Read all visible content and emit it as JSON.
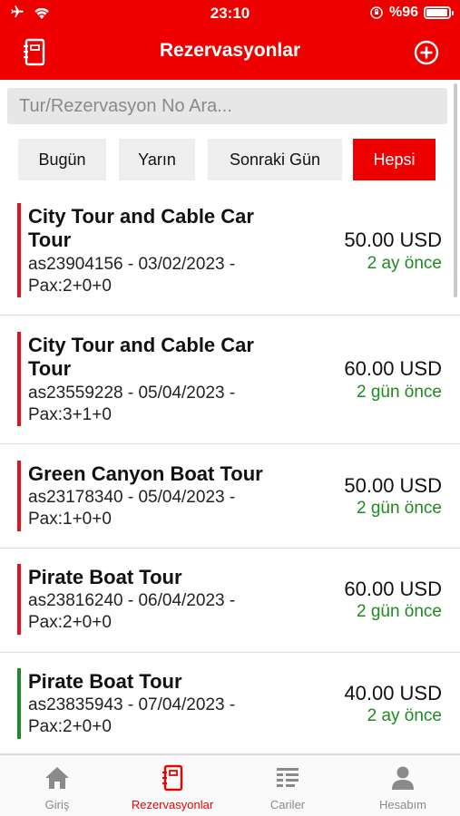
{
  "status_bar": {
    "time": "23:10",
    "battery_text": "%96",
    "icons": [
      "airplane-icon",
      "wifi-icon",
      "orientation-lock-icon",
      "battery-icon"
    ]
  },
  "nav": {
    "title": "Rezervasyonlar",
    "left_icon": "notebook-icon",
    "right_icon": "add-circle-icon"
  },
  "search": {
    "placeholder": "Tur/Rezervasyon No Ara...",
    "value": ""
  },
  "filters": [
    {
      "label": "Bugün",
      "active": false
    },
    {
      "label": "Yarın",
      "active": false
    },
    {
      "label": "Sonraki Gün",
      "active": false
    },
    {
      "label": "Hepsi",
      "active": true
    }
  ],
  "reservations": [
    {
      "title_line1": "City Tour and Cable Car",
      "title_line2": "Tour",
      "info_line1": "as23904156 - 03/02/2023 -",
      "info_line2": "Pax:2+0+0",
      "price": "50.00 USD",
      "ago": "2 ay önce",
      "accent": "#e0141e"
    },
    {
      "title_line1": "City Tour and Cable Car",
      "title_line2": "Tour",
      "info_line1": "as23559228 - 05/04/2023 -",
      "info_line2": "Pax:3+1+0",
      "price": "60.00 USD",
      "ago": "2 gün önce",
      "accent": "#e0141e"
    },
    {
      "title_line1": "Green Canyon Boat Tour",
      "title_line2": "",
      "info_line1": "as23178340 - 05/04/2023 -",
      "info_line2": "Pax:1+0+0",
      "price": "50.00 USD",
      "ago": "2 gün önce",
      "accent": "#e0141e"
    },
    {
      "title_line1": "Pirate Boat Tour",
      "title_line2": "",
      "info_line1": "as23816240 - 06/04/2023 -",
      "info_line2": "Pax:2+0+0",
      "price": "60.00 USD",
      "ago": "2 gün önce",
      "accent": "#e0141e"
    },
    {
      "title_line1": "Pirate Boat Tour",
      "title_line2": "",
      "info_line1": "as23835943 - 07/04/2023 -",
      "info_line2": "Pax:2+0+0",
      "price": "40.00 USD",
      "ago": "2 ay önce",
      "accent": "#1e8a28"
    }
  ],
  "tabs": [
    {
      "label": "Giriş",
      "icon": "home-icon",
      "active": false
    },
    {
      "label": "Rezervasyonlar",
      "icon": "notebook-icon",
      "active": true
    },
    {
      "label": "Cariler",
      "icon": "list-icon",
      "active": false
    },
    {
      "label": "Hesabım",
      "icon": "person-icon",
      "active": false
    }
  ],
  "colors": {
    "brand": "#ee0000",
    "time_ago": "#1f8a1f",
    "tab_inactive": "#8a8a8a"
  }
}
